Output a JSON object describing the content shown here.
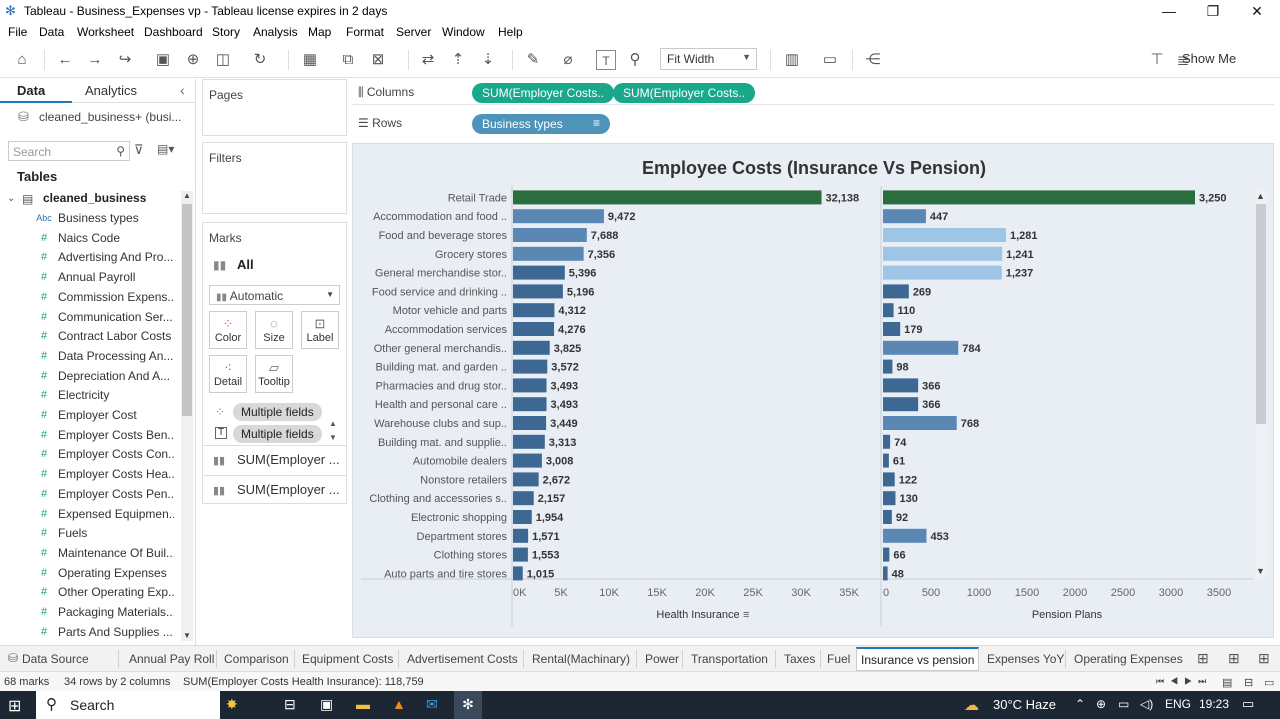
{
  "window": {
    "title": "Tableau - Business_Expenses vp - Tableau license expires in 2 days",
    "minimize": "—",
    "maximize": "❐",
    "close": "✕"
  },
  "menu": [
    "File",
    "Data",
    "Worksheet",
    "Dashboard",
    "Story",
    "Analysis",
    "Map",
    "Format",
    "Server",
    "Window",
    "Help"
  ],
  "toolbar": {
    "fit": "Fit Width",
    "show_me": "Show Me"
  },
  "datapane": {
    "tab_data": "Data",
    "tab_analytics": "Analytics",
    "datasource": "cleaned_business+ (busi...",
    "search_placeholder": "Search",
    "tables_header": "Tables",
    "table_name": "cleaned_business",
    "fields": [
      {
        "type": "Abc",
        "name": "Business types"
      },
      {
        "type": "#",
        "name": "Naics Code"
      },
      {
        "type": "#",
        "name": "Advertising And Pro..."
      },
      {
        "type": "#",
        "name": "Annual Payroll"
      },
      {
        "type": "#",
        "name": "Commission Expens..."
      },
      {
        "type": "#",
        "name": "Communication Ser..."
      },
      {
        "type": "#",
        "name": "Contract Labor Costs"
      },
      {
        "type": "#",
        "name": "Data Processing An..."
      },
      {
        "type": "#",
        "name": "Depreciation And A..."
      },
      {
        "type": "#",
        "name": "Electricity"
      },
      {
        "type": "#",
        "name": "Employer Cost"
      },
      {
        "type": "#",
        "name": "Employer Costs Ben..."
      },
      {
        "type": "#",
        "name": "Employer Costs Con..."
      },
      {
        "type": "#",
        "name": "Employer Costs Hea..."
      },
      {
        "type": "#",
        "name": "Employer Costs Pen..."
      },
      {
        "type": "#",
        "name": "Expensed Equipmen..."
      },
      {
        "type": "#",
        "name": "Fuels"
      },
      {
        "type": "#",
        "name": "Maintenance Of Buil..."
      },
      {
        "type": "#",
        "name": "Operating Expenses"
      },
      {
        "type": "#",
        "name": "Other Operating Exp..."
      },
      {
        "type": "#",
        "name": "Packaging Materials..."
      },
      {
        "type": "#",
        "name": "Parts And Supplies ..."
      }
    ]
  },
  "cards": {
    "pages": "Pages",
    "filters": "Filters",
    "marks": "Marks",
    "marks_all": "All",
    "mark_type": "Automatic",
    "color": "Color",
    "size": "Size",
    "label": "Label",
    "detail": "Detail",
    "tooltip": "Tooltip",
    "multi1": "Multiple fields",
    "multi2": "Multiple fields",
    "sum1": "SUM(Employer ...",
    "sum2": "SUM(Employer ..."
  },
  "shelves": {
    "columns_label": "Columns",
    "rows_label": "Rows",
    "col_pill1": "SUM(Employer Costs..",
    "col_pill2": "SUM(Employer Costs..",
    "row_pill": "Business types"
  },
  "colors": {
    "highlight": "#2a6e3f",
    "bar_dark": "#3d6894",
    "bar_mid": "#5b87b5",
    "bar_light": "#9ec5e6",
    "pill_green": "#1aa88a",
    "pill_blue": "#4e93b8"
  },
  "chart_data": {
    "type": "bar",
    "title": "Employee Costs (Insurance Vs Pension)",
    "categories": [
      "Retail Trade",
      "Accommodation and food ..",
      "Food and beverage stores",
      "Grocery stores",
      "General merchandise stor..",
      "Food service and drinking ..",
      "Motor vehicle and parts",
      "Accommodation services",
      "Other general merchandis..",
      "Building mat. and garden ..",
      "Pharmacies and drug stor..",
      "Health and personal care ..",
      "Warehouse clubs and sup..",
      "Building mat. and supplie..",
      "Automobile dealers",
      "Nonstore retailers",
      "Clothing and accessories s..",
      "Electronic shopping",
      "Department stores",
      "Clothing stores",
      "Auto parts and tire stores"
    ],
    "series": [
      {
        "name": "Health Insurance",
        "values": [
          32138,
          9472,
          7688,
          7356,
          5396,
          5196,
          4312,
          4276,
          3825,
          3572,
          3493,
          3493,
          3449,
          3313,
          3008,
          2672,
          2157,
          1954,
          1571,
          1553,
          1015
        ],
        "labels": [
          "32,138",
          "9,472",
          "7,688",
          "7,356",
          "5,396",
          "5,196",
          "4,312",
          "4,276",
          "3,825",
          "3,572",
          "3,493",
          "3,493",
          "3,449",
          "3,313",
          "3,008",
          "2,672",
          "2,157",
          "1,954",
          "1,571",
          "1,553",
          "1,015"
        ]
      },
      {
        "name": "Pension Plans",
        "values": [
          3250,
          447,
          1281,
          1241,
          1237,
          269,
          110,
          179,
          784,
          98,
          366,
          366,
          768,
          74,
          61,
          122,
          130,
          92,
          453,
          66,
          48
        ],
        "labels": [
          "3,250",
          "447",
          "1,281",
          "1,241",
          "1,237",
          "269",
          "110",
          "179",
          "784",
          "98",
          "366",
          "366",
          "768",
          "74",
          "61",
          "122",
          "130",
          "92",
          "453",
          "66",
          "48"
        ]
      }
    ],
    "xlim1": [
      0,
      35000
    ],
    "xticks1": [
      "0K",
      "5K",
      "10K",
      "15K",
      "20K",
      "25K",
      "30K",
      "35K"
    ],
    "xlim2": [
      0,
      3500
    ],
    "xticks2": [
      "0",
      "500",
      "1000",
      "1500",
      "2000",
      "2500",
      "3000",
      "3500"
    ],
    "xlabel1": "Health Insurance",
    "xlabel2": "Pension Plans"
  },
  "sheets": [
    "Data Source",
    "Annual Pay Roll",
    "Comparison",
    "Equipment Costs",
    "Advertisement Costs",
    "Rental(Machinary)",
    "Power",
    "Transportation",
    "Taxes",
    "Fuel",
    "Insurance vs pension",
    "Expenses YoY",
    "Operating Expenses"
  ],
  "status": {
    "marks": "68 marks",
    "rows": "34 rows by 2 columns",
    "sum": "SUM(Employer Costs Health Insurance): 118,759"
  },
  "taskbar": {
    "search": "Search",
    "weather": "30°C  Haze",
    "lang": "ENG",
    "time": "19:23"
  }
}
